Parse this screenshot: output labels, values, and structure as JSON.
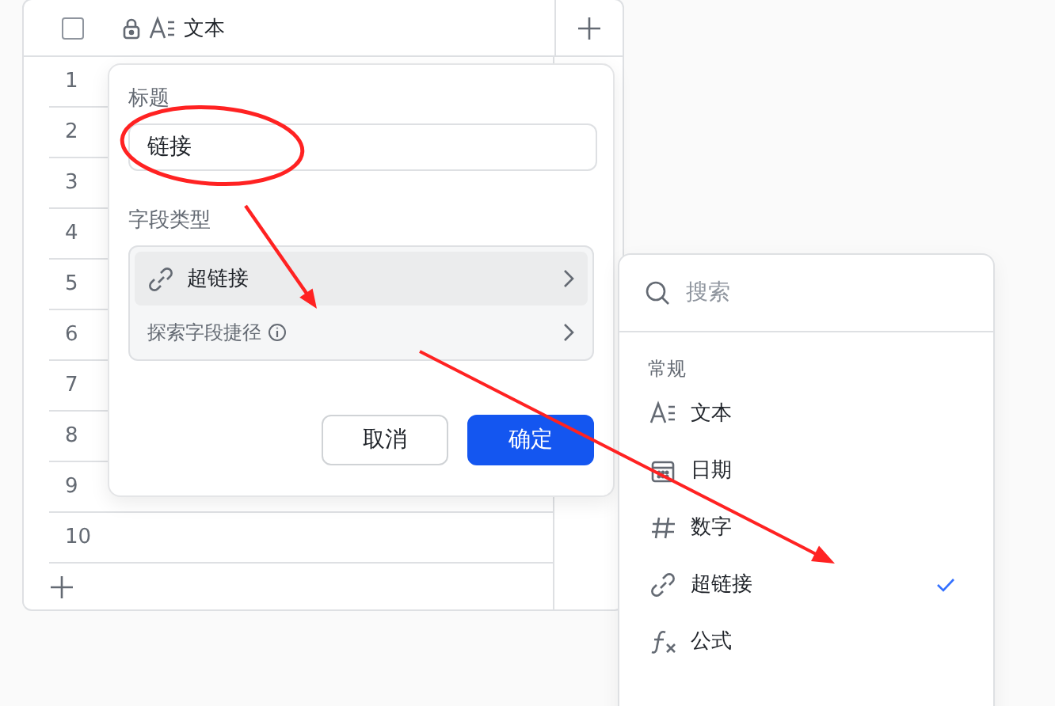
{
  "table": {
    "header": {
      "checked": false,
      "locked": true,
      "column": "文本"
    },
    "rows": [
      "1",
      "2",
      "3",
      "4",
      "5",
      "6",
      "7",
      "8",
      "9",
      "10"
    ]
  },
  "field_dialog": {
    "title_label": "标题",
    "title_value": "链接",
    "type_label": "字段类型",
    "type_value": "超链接",
    "shortcut": "探索字段捷径",
    "buttons": [
      {
        "label": "取消",
        "kind": "secondary"
      },
      {
        "label": "确定",
        "kind": "primary"
      }
    ]
  },
  "type_menu": {
    "search_placeholder": "搜索",
    "group": "常规",
    "items": [
      {
        "label": "文本",
        "kind": "text",
        "selected": false
      },
      {
        "label": "日期",
        "kind": "date",
        "selected": false
      },
      {
        "label": "数字",
        "kind": "number",
        "selected": false
      },
      {
        "label": "超链接",
        "kind": "link",
        "selected": true
      },
      {
        "label": "公式",
        "kind": "formula",
        "selected": false
      }
    ]
  }
}
